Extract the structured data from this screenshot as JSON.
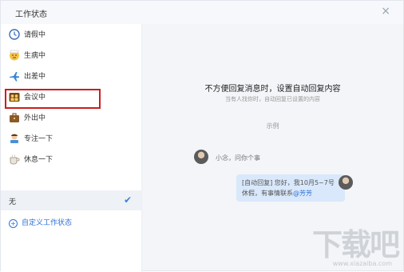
{
  "dialog": {
    "title": "工作状态",
    "close_symbol": "×"
  },
  "statuses": [
    {
      "label": "请假中",
      "icon": "clock-icon"
    },
    {
      "label": "生病中",
      "icon": "sick-face-icon"
    },
    {
      "label": "出差中",
      "icon": "airplane-icon"
    },
    {
      "label": "会议中",
      "icon": "meeting-icon",
      "selected_highlight": true
    },
    {
      "label": "外出中",
      "icon": "briefcase-icon"
    },
    {
      "label": "专注一下",
      "icon": "focus-person-icon"
    },
    {
      "label": "休息一下",
      "icon": "coffee-icon"
    }
  ],
  "none_option": {
    "label": "无",
    "check": "✔"
  },
  "custom_link": {
    "label": "自定义工作状态"
  },
  "preview": {
    "heading": "不方便回复消息时，设置自动回复内容",
    "subheading": "当有人找你时，自动回复已设置的内容",
    "example_label": "示例",
    "incoming_message": "小念，问你个事",
    "reply_prefix": "[自动回复] 您好，我10月5~7号休假，有事情联系",
    "reply_contact": "@芳芳"
  },
  "watermark": {
    "text": "下载吧",
    "url_text": "www.xiazaiba.com"
  },
  "colors": {
    "accent": "#2e72d8",
    "highlight_border": "#cc1d1d",
    "panel_bg": "#f3f5f8"
  }
}
